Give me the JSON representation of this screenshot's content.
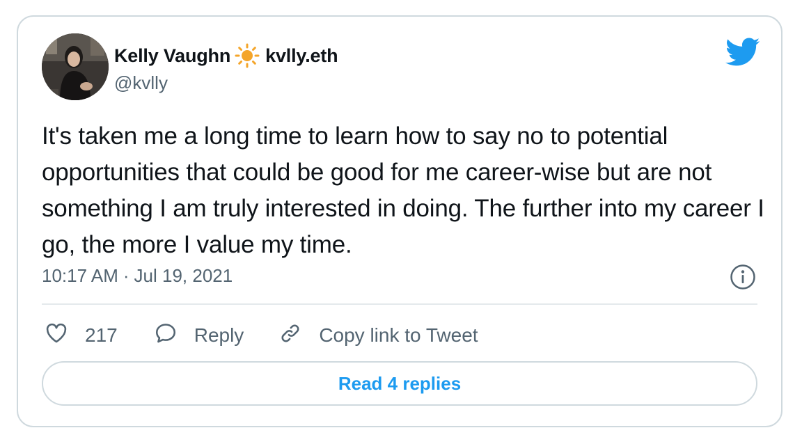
{
  "tweet": {
    "author": {
      "display_name": "Kelly Vaughn",
      "name_emoji": "sun-emoji",
      "name_suffix": "kvlly.eth",
      "handle": "@kvlly",
      "avatar": "profile-photo"
    },
    "text": "It's taken me a long time to learn how to say no to potential opportunities that could be good for me career-wise but are not something I am truly interested in doing. The further into my career I go, the more I value my time.",
    "time": "10:17 AM",
    "separator": "·",
    "date": "Jul 19, 2021"
  },
  "actions": {
    "like_count": "217",
    "reply_label": "Reply",
    "copy_link_label": "Copy link to Tweet",
    "read_replies_label": "Read 4 replies"
  },
  "icons": {
    "brand": "twitter-bird-icon",
    "info": "info-icon",
    "like": "heart-icon",
    "reply": "speech-bubble-icon",
    "copy": "link-icon"
  },
  "colors": {
    "accent": "#1d9bf0",
    "text": "#0f1419",
    "secondary_text": "#536471",
    "border": "#cfd9de",
    "sun": "#f4a52a"
  }
}
